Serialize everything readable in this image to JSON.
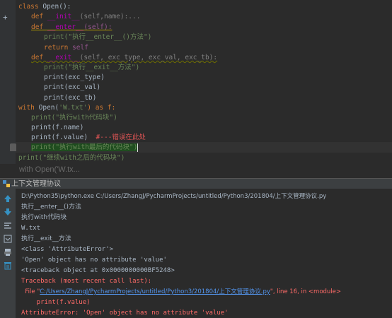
{
  "editor": {
    "lines": {
      "l1_class": "class ",
      "l1_name": "Open",
      "l1_rest": "():",
      "l2_def": "def ",
      "l2_fn": "__init__",
      "l2_args": "(self,name):...",
      "l3_def": "def ",
      "l3_fn": "__enter__",
      "l3_args": "(self):",
      "l4": "print(\"执行__enter__()方法\")",
      "l5_kw": "return ",
      "l5_self": "self",
      "l6_def": "def ",
      "l6_fn": "__exit__",
      "l6_args": "(self, exc_type, exc_val, exc_tb):",
      "l7": "print(\"执行__exit__方法\")",
      "l8": "print(exc_type)",
      "l9": "print(exc_val)",
      "l10": "print(exc_tb)",
      "l11_with": "with ",
      "l11_call": "Open(",
      "l11_str": "'W.txt'",
      "l11_as": ") as f:",
      "l12": "print(\"执行with代码块\")",
      "l13": "print(f.name)",
      "l14_code": "print(f.value)",
      "l14_comment": "#---错误在此处",
      "l15": "print(\"执行with最后的代码块\")",
      "l16": "print(\"继续with之后的代码块\")"
    },
    "breadcrumb": "with Open('W.tx..."
  },
  "run_panel": {
    "title": "上下文管理协议",
    "output": {
      "o1": "D:\\Python35\\python.exe C:/Users/ZhangJ/PycharmProjects/untitled/Python3/201804/上下文管理协议.py",
      "o2": "执行__enter__()方法",
      "o3": "执行with代码块",
      "o4": "W.txt",
      "o5": "执行__exit__方法",
      "o6": "<class 'AttributeError'>",
      "o7": "'Open' object has no attribute 'value'",
      "o8": "<traceback object at 0x0000000000BF5248>",
      "o9": "Traceback (most recent call last):",
      "o10_pre": "  File \"",
      "o10_link": "C:/Users/ZhangJ/PycharmProjects/untitled/Python3/201804/上下文管理协议.py",
      "o10_post": "\", line 16, in <module>",
      "o11": "    print(f.value)",
      "o12": "AttributeError: 'Open' object has no attribute 'value'"
    }
  },
  "colors": {
    "keyword": "#cc7832",
    "function": "#ffc66d",
    "string": "#6a8759",
    "error": "#ff6b68",
    "link": "#5394ec"
  }
}
